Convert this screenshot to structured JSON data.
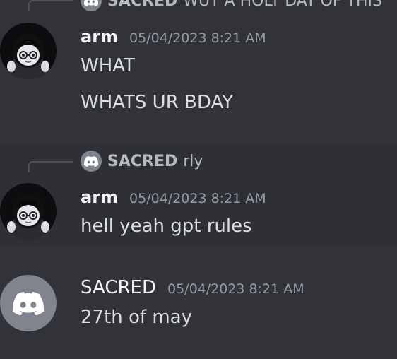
{
  "messages": [
    {
      "reply": {
        "author": "SACRED",
        "text": "WUT A HOLY DAY OF THIS"
      },
      "author": "arm",
      "timestamp": "05/04/2023 8:21 AM",
      "lines": [
        "WHAT",
        "WHATS UR BDAY"
      ]
    },
    {
      "reply": {
        "author": "SACRED",
        "text": "rly"
      },
      "author": "arm",
      "timestamp": "05/04/2023 8:21 AM",
      "lines": [
        "hell yeah gpt rules"
      ]
    },
    {
      "author": "SACRED",
      "timestamp": "05/04/2023 8:21 AM",
      "lines": [
        "27th of may"
      ]
    }
  ],
  "icons": {
    "reply_avatar": "discord-logo-icon",
    "sacred_avatar": "discord-logo-icon",
    "arm_avatar": "anime-character-avatar"
  },
  "colors": {
    "background": "#313338",
    "discord_avatar_bg": "#80848e",
    "username": "#f2f3f5",
    "timestamp": "#949ba4"
  }
}
